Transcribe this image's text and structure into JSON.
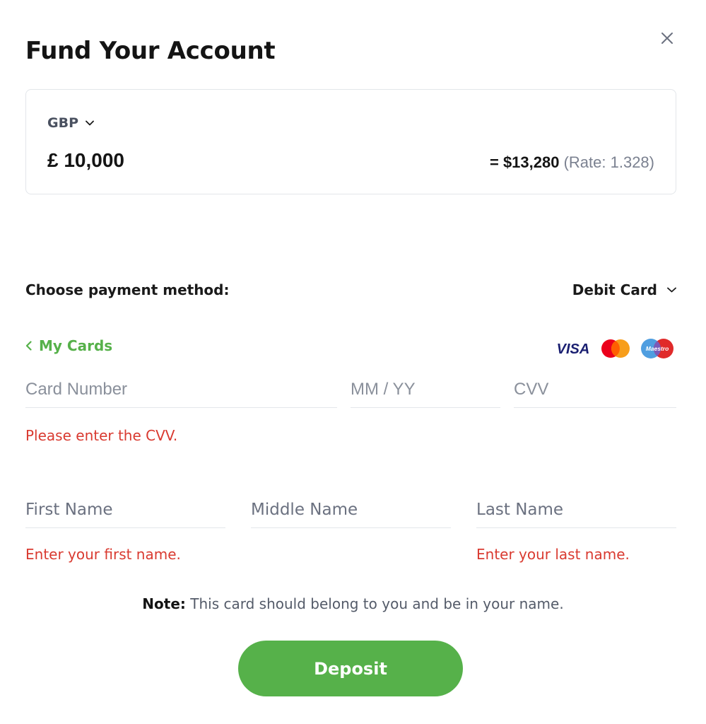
{
  "modal": {
    "title": "Fund Your Account",
    "close_icon": "close-icon"
  },
  "amount": {
    "currency": "GBP",
    "value": "£ 10,000",
    "converted": "= $13,280",
    "rate": "(Rate: 1.328)"
  },
  "payment": {
    "label": "Choose payment method:",
    "method": "Debit Card"
  },
  "cards": {
    "back_label": "My Cards",
    "brands": [
      "VISA",
      "Mastercard",
      "Maestro"
    ]
  },
  "card_form": {
    "number_placeholder": "Card Number",
    "expiry_placeholder": "MM / YY",
    "cvv_placeholder": "CVV",
    "cvv_error": "Please enter the CVV."
  },
  "name_form": {
    "first_placeholder": "First Name",
    "middle_placeholder": "Middle Name",
    "last_placeholder": "Last Name",
    "first_error": "Enter your first name.",
    "last_error": "Enter your last name."
  },
  "note": {
    "label": "Note:",
    "text": "This card should belong to you and be in your name."
  },
  "deposit_label": "Deposit",
  "colors": {
    "accent_green": "#56b14a",
    "error_red": "#d93a30",
    "visa_blue": "#1a1f71",
    "mastercard_red": "#eb001b",
    "mastercard_orange": "#f79e1b",
    "maestro_blue": "#4f9ee0"
  }
}
